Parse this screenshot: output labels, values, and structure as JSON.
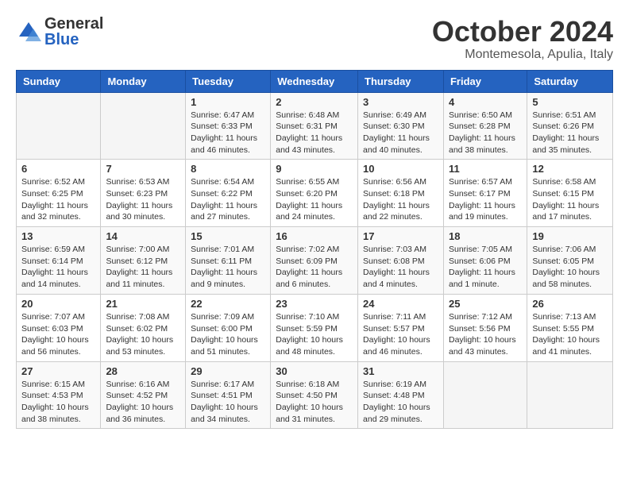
{
  "logo": {
    "text_general": "General",
    "text_blue": "Blue",
    "icon_color": "#2563c0"
  },
  "title": {
    "month": "October 2024",
    "location": "Montemesola, Apulia, Italy"
  },
  "weekdays": [
    "Sunday",
    "Monday",
    "Tuesday",
    "Wednesday",
    "Thursday",
    "Friday",
    "Saturday"
  ],
  "weeks": [
    [
      {
        "day": "",
        "sunrise": "",
        "sunset": "",
        "daylight": ""
      },
      {
        "day": "",
        "sunrise": "",
        "sunset": "",
        "daylight": ""
      },
      {
        "day": "1",
        "sunrise": "Sunrise: 6:47 AM",
        "sunset": "Sunset: 6:33 PM",
        "daylight": "Daylight: 11 hours and 46 minutes."
      },
      {
        "day": "2",
        "sunrise": "Sunrise: 6:48 AM",
        "sunset": "Sunset: 6:31 PM",
        "daylight": "Daylight: 11 hours and 43 minutes."
      },
      {
        "day": "3",
        "sunrise": "Sunrise: 6:49 AM",
        "sunset": "Sunset: 6:30 PM",
        "daylight": "Daylight: 11 hours and 40 minutes."
      },
      {
        "day": "4",
        "sunrise": "Sunrise: 6:50 AM",
        "sunset": "Sunset: 6:28 PM",
        "daylight": "Daylight: 11 hours and 38 minutes."
      },
      {
        "day": "5",
        "sunrise": "Sunrise: 6:51 AM",
        "sunset": "Sunset: 6:26 PM",
        "daylight": "Daylight: 11 hours and 35 minutes."
      }
    ],
    [
      {
        "day": "6",
        "sunrise": "Sunrise: 6:52 AM",
        "sunset": "Sunset: 6:25 PM",
        "daylight": "Daylight: 11 hours and 32 minutes."
      },
      {
        "day": "7",
        "sunrise": "Sunrise: 6:53 AM",
        "sunset": "Sunset: 6:23 PM",
        "daylight": "Daylight: 11 hours and 30 minutes."
      },
      {
        "day": "8",
        "sunrise": "Sunrise: 6:54 AM",
        "sunset": "Sunset: 6:22 PM",
        "daylight": "Daylight: 11 hours and 27 minutes."
      },
      {
        "day": "9",
        "sunrise": "Sunrise: 6:55 AM",
        "sunset": "Sunset: 6:20 PM",
        "daylight": "Daylight: 11 hours and 24 minutes."
      },
      {
        "day": "10",
        "sunrise": "Sunrise: 6:56 AM",
        "sunset": "Sunset: 6:18 PM",
        "daylight": "Daylight: 11 hours and 22 minutes."
      },
      {
        "day": "11",
        "sunrise": "Sunrise: 6:57 AM",
        "sunset": "Sunset: 6:17 PM",
        "daylight": "Daylight: 11 hours and 19 minutes."
      },
      {
        "day": "12",
        "sunrise": "Sunrise: 6:58 AM",
        "sunset": "Sunset: 6:15 PM",
        "daylight": "Daylight: 11 hours and 17 minutes."
      }
    ],
    [
      {
        "day": "13",
        "sunrise": "Sunrise: 6:59 AM",
        "sunset": "Sunset: 6:14 PM",
        "daylight": "Daylight: 11 hours and 14 minutes."
      },
      {
        "day": "14",
        "sunrise": "Sunrise: 7:00 AM",
        "sunset": "Sunset: 6:12 PM",
        "daylight": "Daylight: 11 hours and 11 minutes."
      },
      {
        "day": "15",
        "sunrise": "Sunrise: 7:01 AM",
        "sunset": "Sunset: 6:11 PM",
        "daylight": "Daylight: 11 hours and 9 minutes."
      },
      {
        "day": "16",
        "sunrise": "Sunrise: 7:02 AM",
        "sunset": "Sunset: 6:09 PM",
        "daylight": "Daylight: 11 hours and 6 minutes."
      },
      {
        "day": "17",
        "sunrise": "Sunrise: 7:03 AM",
        "sunset": "Sunset: 6:08 PM",
        "daylight": "Daylight: 11 hours and 4 minutes."
      },
      {
        "day": "18",
        "sunrise": "Sunrise: 7:05 AM",
        "sunset": "Sunset: 6:06 PM",
        "daylight": "Daylight: 11 hours and 1 minute."
      },
      {
        "day": "19",
        "sunrise": "Sunrise: 7:06 AM",
        "sunset": "Sunset: 6:05 PM",
        "daylight": "Daylight: 10 hours and 58 minutes."
      }
    ],
    [
      {
        "day": "20",
        "sunrise": "Sunrise: 7:07 AM",
        "sunset": "Sunset: 6:03 PM",
        "daylight": "Daylight: 10 hours and 56 minutes."
      },
      {
        "day": "21",
        "sunrise": "Sunrise: 7:08 AM",
        "sunset": "Sunset: 6:02 PM",
        "daylight": "Daylight: 10 hours and 53 minutes."
      },
      {
        "day": "22",
        "sunrise": "Sunrise: 7:09 AM",
        "sunset": "Sunset: 6:00 PM",
        "daylight": "Daylight: 10 hours and 51 minutes."
      },
      {
        "day": "23",
        "sunrise": "Sunrise: 7:10 AM",
        "sunset": "Sunset: 5:59 PM",
        "daylight": "Daylight: 10 hours and 48 minutes."
      },
      {
        "day": "24",
        "sunrise": "Sunrise: 7:11 AM",
        "sunset": "Sunset: 5:57 PM",
        "daylight": "Daylight: 10 hours and 46 minutes."
      },
      {
        "day": "25",
        "sunrise": "Sunrise: 7:12 AM",
        "sunset": "Sunset: 5:56 PM",
        "daylight": "Daylight: 10 hours and 43 minutes."
      },
      {
        "day": "26",
        "sunrise": "Sunrise: 7:13 AM",
        "sunset": "Sunset: 5:55 PM",
        "daylight": "Daylight: 10 hours and 41 minutes."
      }
    ],
    [
      {
        "day": "27",
        "sunrise": "Sunrise: 6:15 AM",
        "sunset": "Sunset: 4:53 PM",
        "daylight": "Daylight: 10 hours and 38 minutes."
      },
      {
        "day": "28",
        "sunrise": "Sunrise: 6:16 AM",
        "sunset": "Sunset: 4:52 PM",
        "daylight": "Daylight: 10 hours and 36 minutes."
      },
      {
        "day": "29",
        "sunrise": "Sunrise: 6:17 AM",
        "sunset": "Sunset: 4:51 PM",
        "daylight": "Daylight: 10 hours and 34 minutes."
      },
      {
        "day": "30",
        "sunrise": "Sunrise: 6:18 AM",
        "sunset": "Sunset: 4:50 PM",
        "daylight": "Daylight: 10 hours and 31 minutes."
      },
      {
        "day": "31",
        "sunrise": "Sunrise: 6:19 AM",
        "sunset": "Sunset: 4:48 PM",
        "daylight": "Daylight: 10 hours and 29 minutes."
      },
      {
        "day": "",
        "sunrise": "",
        "sunset": "",
        "daylight": ""
      },
      {
        "day": "",
        "sunrise": "",
        "sunset": "",
        "daylight": ""
      }
    ]
  ]
}
